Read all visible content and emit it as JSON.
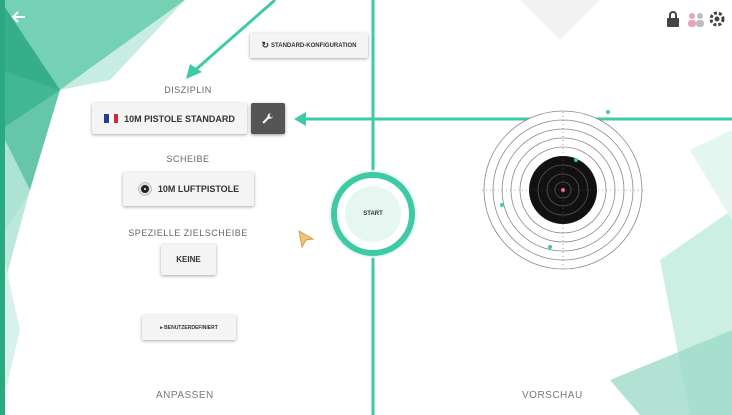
{
  "header": {
    "back_icon": "arrow-left-icon",
    "icons": [
      "lock-icon",
      "people-icon",
      "gear-icon"
    ]
  },
  "config": {
    "standard_label": "STANDARD-KONFIGURATION",
    "discipline_label": "DISZIPLIN",
    "discipline_value": "10M PISTOLE STANDARD",
    "discipline_flag": "france-flag-icon",
    "target_label": "SCHEIBE",
    "target_value": "10M LUFTPISTOLE",
    "special_label": "SPEZIELLE ZIELSCHEIBE",
    "special_value": "KEINE",
    "custom_label": "▸ BENUTZERDEFINIERT",
    "footer_left": "ANPASSEN"
  },
  "start": {
    "label": "START"
  },
  "preview": {
    "footer_right": "VORSCHAU"
  },
  "colors": {
    "accent": "#3ec9a7",
    "button_bg": "#f4f4f4",
    "dark_button": "#555555"
  }
}
